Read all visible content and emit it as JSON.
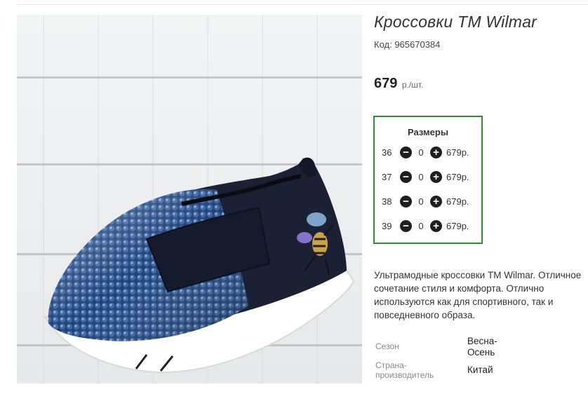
{
  "product": {
    "title": "Кроссовки ТМ Wilmar",
    "code": "Код: 965670384",
    "price_value": "679",
    "price_unit": "р./шт."
  },
  "sizes_panel": {
    "title": "Размеры",
    "rows": [
      {
        "size": "36",
        "qty": "0",
        "price": "679р."
      },
      {
        "size": "37",
        "qty": "0",
        "price": "679р."
      },
      {
        "size": "38",
        "qty": "0",
        "price": "679р."
      },
      {
        "size": "39",
        "qty": "0",
        "price": "679р."
      }
    ],
    "minus_icon": "minus-circle-icon",
    "plus_icon": "plus-circle-icon"
  },
  "description": "Ультрамодные кроссовки ТМ Wilmar. Отличное сочетание стиля и комфорта. Отлично используются как для спортивного, так и повседневного образа.",
  "attributes": [
    {
      "label": "Сезон",
      "value_line1": "Весна-",
      "value_line2": "Осень"
    },
    {
      "label_line1": "Страна-",
      "label_line2": "производитель",
      "value": "Китай"
    }
  ],
  "colors": {
    "sizes_border": "#2f8f2f",
    "sequins": "#2a4f8f",
    "fabric": "#1b2035"
  }
}
